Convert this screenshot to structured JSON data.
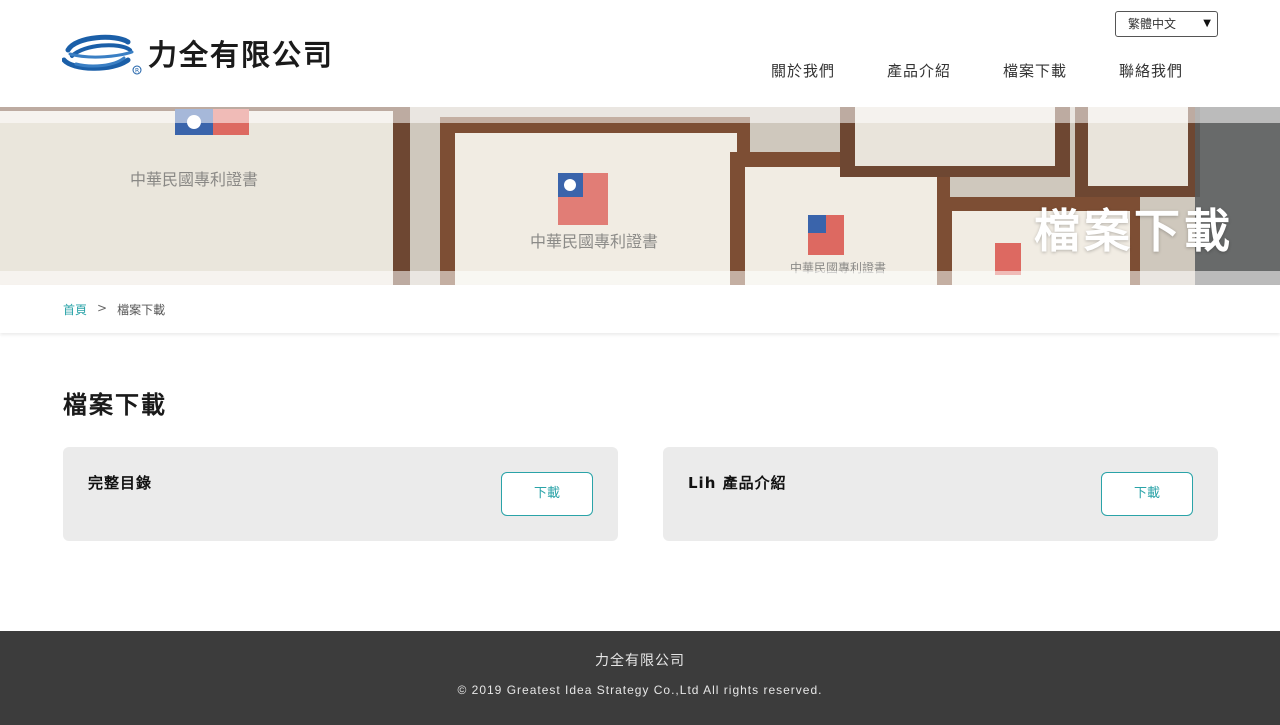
{
  "header": {
    "company_name": "力全有限公司",
    "logo_mark": "swirl-logo-icon",
    "language": {
      "selected": "繁體中文"
    },
    "nav": [
      {
        "label": "關於我們"
      },
      {
        "label": "產品介紹"
      },
      {
        "label": "檔案下載"
      },
      {
        "label": "聯絡我們"
      }
    ]
  },
  "banner": {
    "title": "檔案下載",
    "image": "framed-patent-certificates-photo"
  },
  "breadcrumb": {
    "home": "首頁",
    "separator": ">",
    "current": "檔案下載"
  },
  "main": {
    "title": "檔案下載",
    "downloads": [
      {
        "name": "完整目錄",
        "button": "下載"
      },
      {
        "name": "Lih 產品介紹",
        "button": "下載"
      }
    ]
  },
  "footer": {
    "company": "力全有限公司",
    "copyright": "© 2019 Greatest Idea Strategy Co.,Ltd All rights reserved."
  },
  "colors": {
    "accent": "#2aa3a8",
    "footer_bg": "#3c3c3c",
    "card_bg": "#ebebeb",
    "logo_blue": "#1b5fa8"
  }
}
